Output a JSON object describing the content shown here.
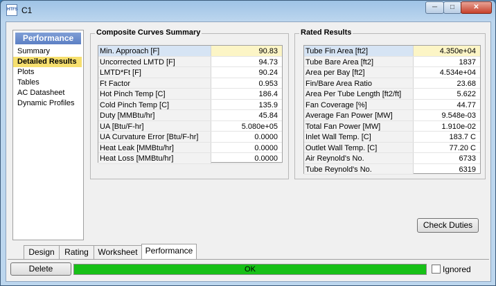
{
  "window": {
    "title": "C1",
    "icon_text": "HTFS"
  },
  "nav": {
    "header": "Performance",
    "items": [
      "Summary",
      "Detailed Results",
      "Plots",
      "Tables",
      "AC Datasheet",
      "Dynamic Profiles"
    ],
    "active_index": 1
  },
  "composite": {
    "title": "Composite Curves Summary",
    "rows": [
      {
        "label": "Min. Approach [F]",
        "value": "90.83"
      },
      {
        "label": "Uncorrected LMTD [F]",
        "value": "94.73"
      },
      {
        "label": "LMTD*Ft [F]",
        "value": "90.24"
      },
      {
        "label": "Ft Factor",
        "value": "0.953"
      },
      {
        "label": "Hot Pinch Temp [C]",
        "value": "186.4"
      },
      {
        "label": "Cold Pinch Temp [C]",
        "value": "135.9"
      },
      {
        "label": "Duty [MMBtu/hr]",
        "value": "45.84"
      },
      {
        "label": "UA [Btu/F-hr]",
        "value": "5.080e+05"
      },
      {
        "label": "UA Curvature Error  [Btu/F-hr]",
        "value": "0.0000"
      },
      {
        "label": "Heat Leak [MMBtu/hr]",
        "value": "0.0000"
      },
      {
        "label": "Heat Loss [MMBtu/hr]",
        "value": "0.0000"
      }
    ]
  },
  "rated": {
    "title": "Rated Results",
    "rows": [
      {
        "label": "Tube Fin Area [ft2]",
        "value": "4.350e+04"
      },
      {
        "label": "Tube Bare Area [ft2]",
        "value": "1837"
      },
      {
        "label": "Area per Bay [ft2]",
        "value": "4.534e+04"
      },
      {
        "label": "Fin/Bare Area Ratio",
        "value": "23.68"
      },
      {
        "label": "Area Per Tube Length [ft2/ft]",
        "value": "5.622"
      },
      {
        "label": "Fan Coverage [%]",
        "value": "44.77"
      },
      {
        "label": "Average Fan Power [MW]",
        "value": "9.548e-03"
      },
      {
        "label": "Total Fan Power [MW]",
        "value": "1.910e-02"
      },
      {
        "label": "Inlet Wall Temp. [C]",
        "value": "183.7 C"
      },
      {
        "label": "Outlet Wall Temp. [C]",
        "value": "77.20 C"
      },
      {
        "label": "Air Reynold's No.",
        "value": "6733"
      },
      {
        "label": "Tube Reynold's No.",
        "value": "6319"
      }
    ]
  },
  "buttons": {
    "check_duties": "Check Duties",
    "delete": "Delete"
  },
  "tabs": [
    "Design",
    "Rating",
    "Worksheet",
    "Performance"
  ],
  "active_tab": 3,
  "status": {
    "text": "OK",
    "color": "#17c017"
  },
  "ignored": {
    "label": "Ignored",
    "checked": false
  }
}
